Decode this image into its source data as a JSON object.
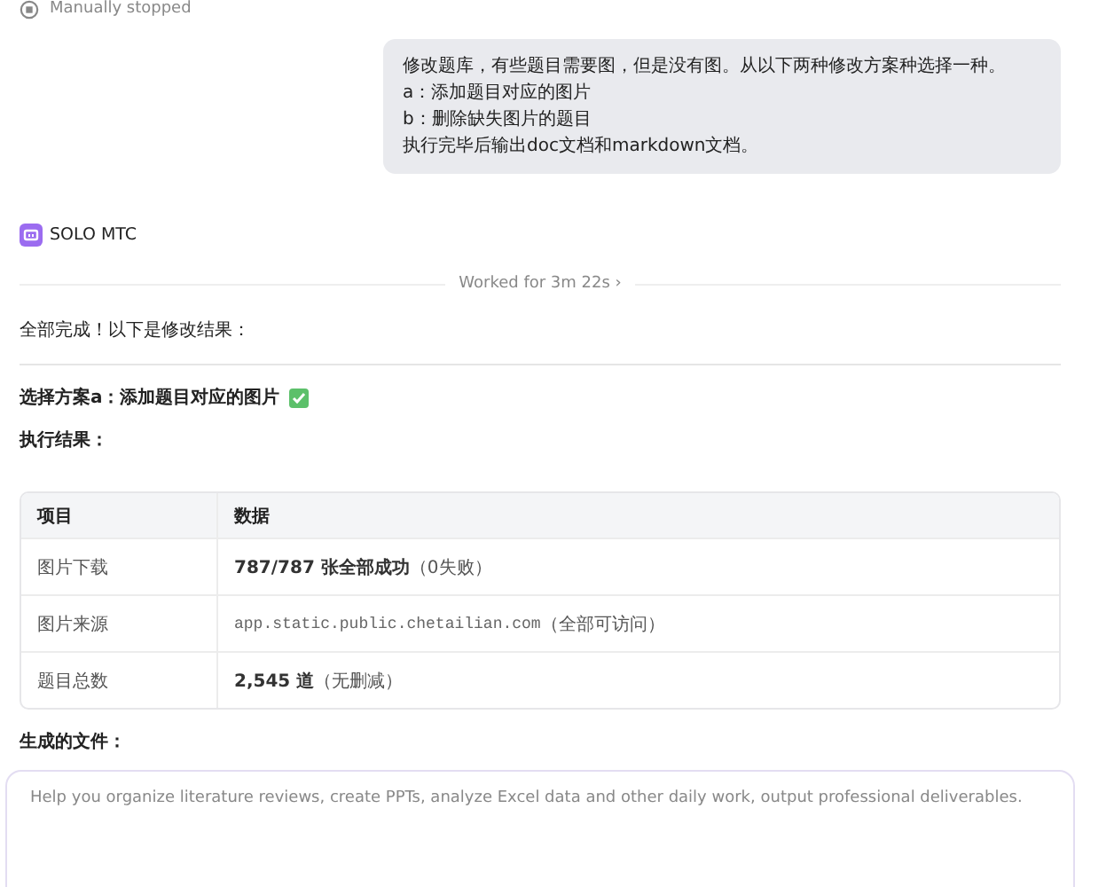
{
  "status": {
    "label": "Manually stopped"
  },
  "user_message": {
    "lines": [
      "修改题库，有些题目需要图，但是没有图。从以下两种修改方案种选择一种。",
      "a：添加题目对应的图片",
      "b：删除缺失图片的题目",
      "执行完毕后输出doc文档和markdown文档。"
    ]
  },
  "agent": {
    "name": "SOLO MTC"
  },
  "worked": {
    "label": "Worked for 3m 22s",
    "chevron": "›"
  },
  "intro": "全部完成！以下是修改结果：",
  "choice": {
    "text": "选择方案a：添加题目对应的图片",
    "checked": true
  },
  "result_heading": "执行结果：",
  "table": {
    "columns": [
      "项目",
      "数据"
    ],
    "rows": [
      {
        "item": "图片下载",
        "data": [
          {
            "kind": "bold",
            "text": "787/787 张全部成功"
          },
          {
            "kind": "plain",
            "text": "（0失败）"
          }
        ]
      },
      {
        "item": "图片来源",
        "data": [
          {
            "kind": "code",
            "text": "app.static.public.chetailian.com"
          },
          {
            "kind": "plain",
            "text": "（全部可访问）"
          }
        ]
      },
      {
        "item": "题目总数",
        "data": [
          {
            "kind": "bold",
            "text": "2,545 道"
          },
          {
            "kind": "plain",
            "text": "（无删减）"
          }
        ]
      }
    ]
  },
  "files_heading": "生成的文件：",
  "composer": {
    "placeholder": "Help you organize literature reviews, create PPTs, analyze Excel data and other daily work, output professional deliverables."
  }
}
